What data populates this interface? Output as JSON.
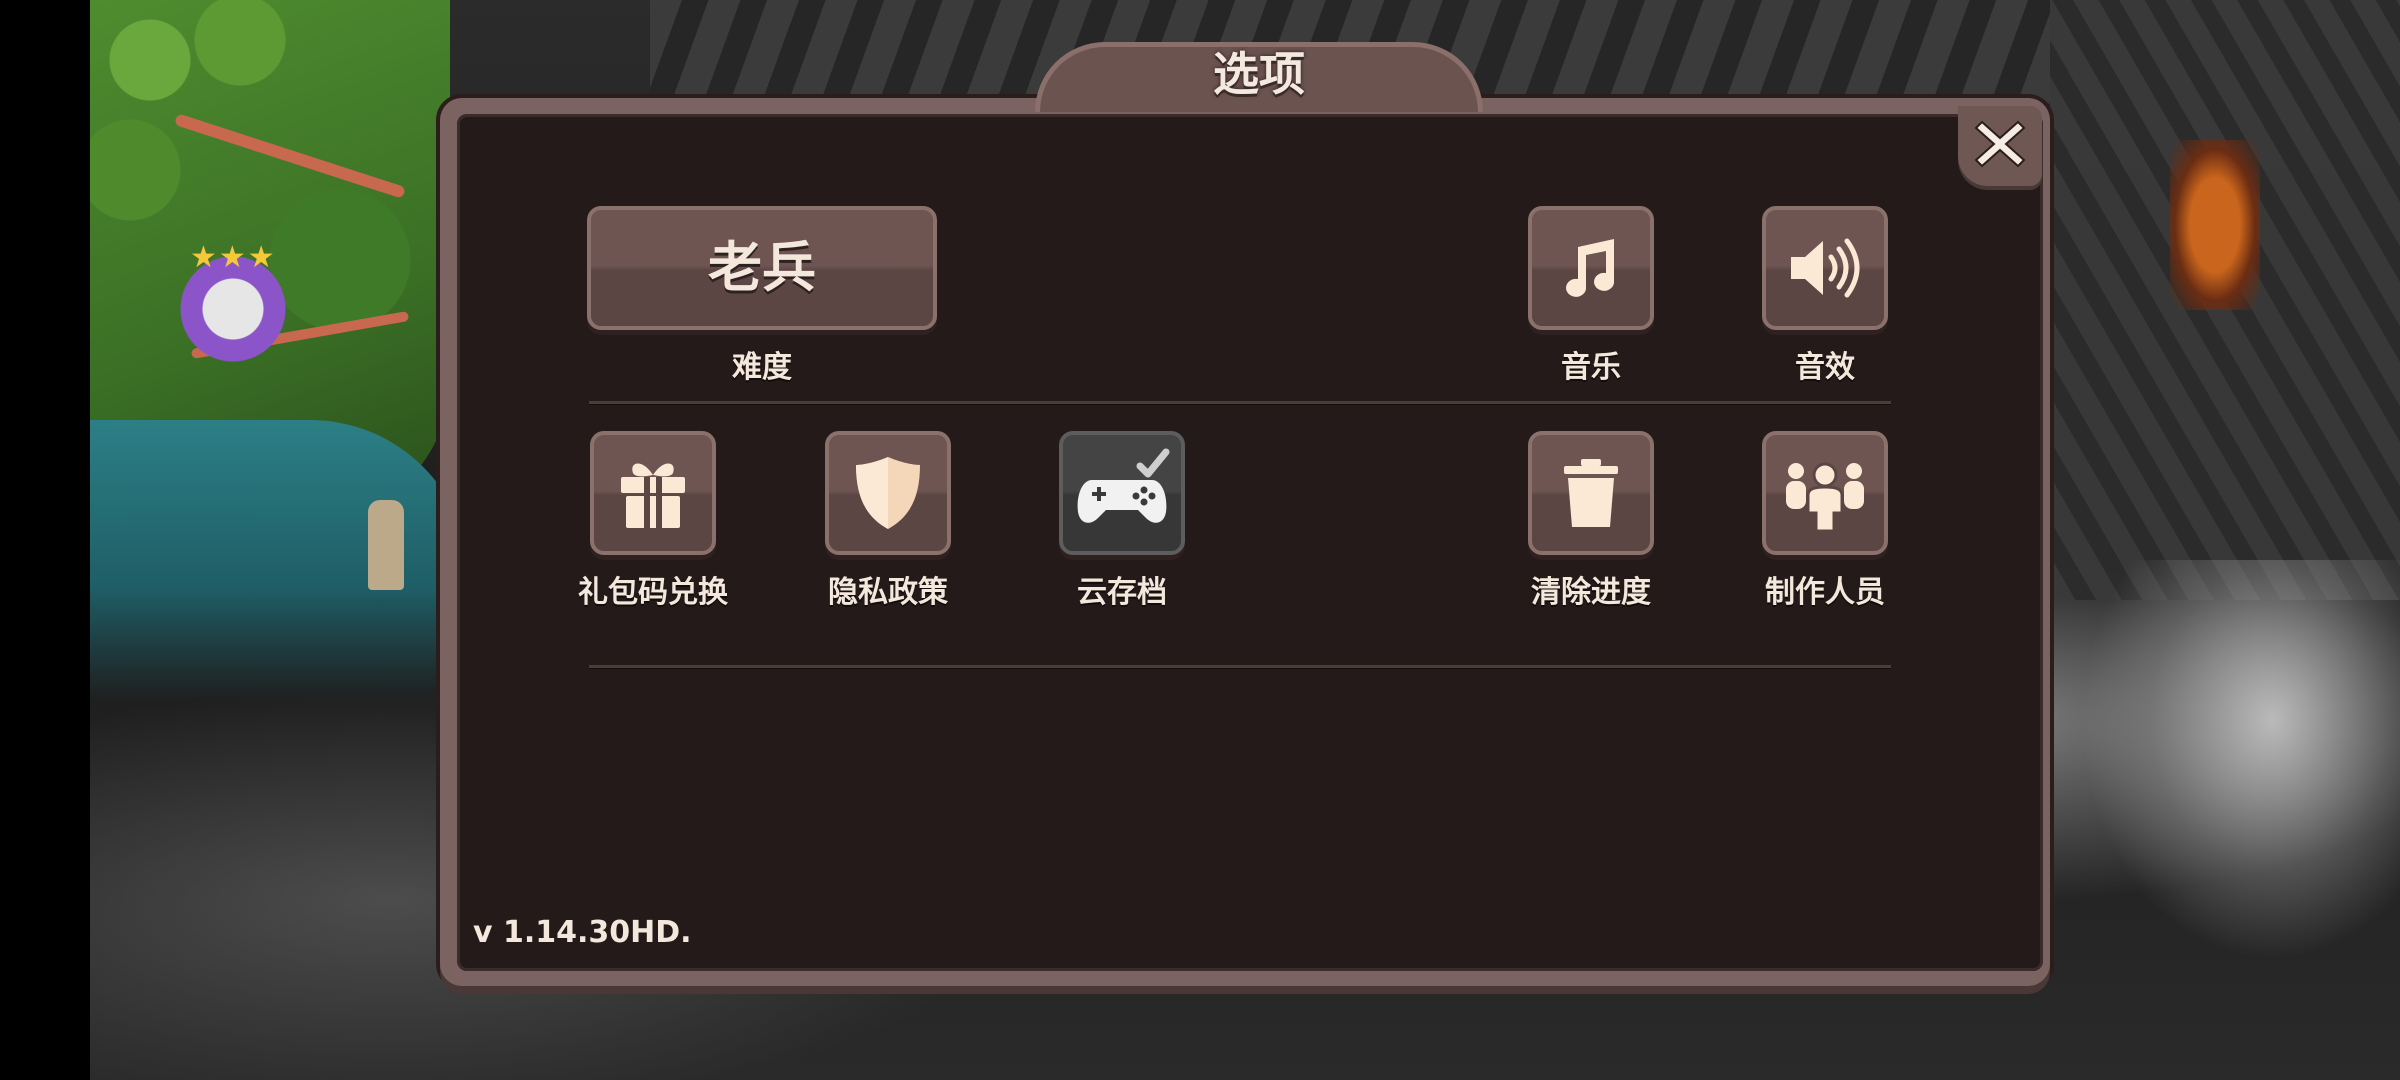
{
  "dialog": {
    "title": "选项",
    "close_icon": "close-icon",
    "version": "v 1.14.30HD."
  },
  "difficulty": {
    "value": "老兵",
    "label": "难度"
  },
  "audio": {
    "music_label": "音乐",
    "music_icon": "music-note-icon",
    "sfx_label": "音效",
    "sfx_icon": "speaker-icon"
  },
  "actions": [
    {
      "label": "礼包码兑换",
      "icon": "gift-icon"
    },
    {
      "label": "隐私政策",
      "icon": "shield-icon"
    },
    {
      "label": "云存档",
      "icon": "gamepad-check-icon"
    },
    {
      "label": "清除进度",
      "icon": "trash-icon"
    },
    {
      "label": "制作人员",
      "icon": "people-icon"
    }
  ],
  "colors": {
    "panel_bg": "#231a19",
    "frame": "#7a6360",
    "button": "#6e5552",
    "text": "#f4e7dc"
  }
}
